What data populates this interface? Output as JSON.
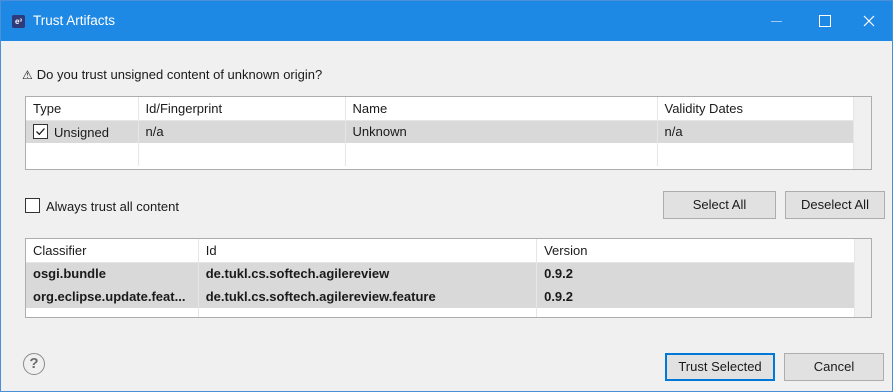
{
  "window": {
    "title": "Trust Artifacts",
    "app_icon_text": "e³"
  },
  "prompt": {
    "icon": "warning-icon",
    "text": "Do you trust unsigned content of unknown origin?"
  },
  "signers_table": {
    "columns": [
      "Type",
      "Id/Fingerprint",
      "Name",
      "Validity Dates"
    ],
    "rows": [
      {
        "checked": true,
        "type": "Unsigned",
        "id": "n/a",
        "name": "Unknown",
        "validity": "n/a"
      }
    ]
  },
  "always_trust": {
    "label": "Always trust all content",
    "checked": false
  },
  "buttons": {
    "select_all": "Select All",
    "deselect_all": "Deselect All",
    "trust_selected": "Trust Selected",
    "cancel": "Cancel"
  },
  "artifacts_table": {
    "columns": [
      "Classifier",
      "Id",
      "Version"
    ],
    "rows": [
      {
        "classifier": "osgi.bundle",
        "id": "de.tukl.cs.softech.agilereview",
        "version": "0.9.2"
      },
      {
        "classifier": "org.eclipse.update.feat...",
        "id": "de.tukl.cs.softech.agilereview.feature",
        "version": "0.9.2"
      }
    ]
  },
  "help": {
    "glyph": "?",
    "icon": "help-icon"
  },
  "colors": {
    "titlebar": "#1e88e5",
    "selection": "#d9d9d9",
    "default_button_border": "#0078d7"
  }
}
